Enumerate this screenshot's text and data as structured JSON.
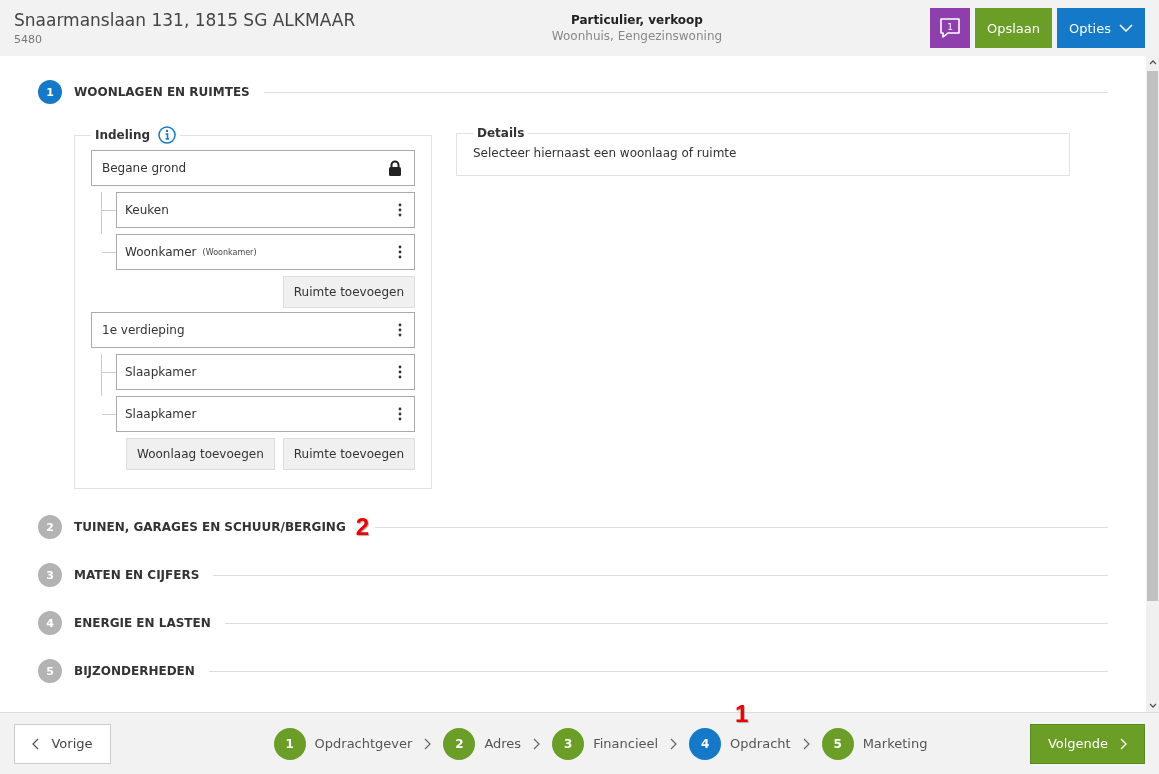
{
  "header": {
    "address": "Snaarmanslaan 131, 1815 SG ALKMAAR",
    "id": "5480",
    "type_title": "Particulier, verkoop",
    "type_subtitle": "Woonhuis, Eengezinswoning",
    "message_count": "1",
    "save_label": "Opslaan",
    "options_label": "Opties"
  },
  "sections": [
    {
      "number": "1",
      "title": "WOONLAGEN EN RUIMTES",
      "selected": true
    },
    {
      "number": "2",
      "title": "TUINEN, GARAGES EN SCHUUR/BERGING",
      "selected": false,
      "callout": "2"
    },
    {
      "number": "3",
      "title": "MATEN EN CIJFERS",
      "selected": false
    },
    {
      "number": "4",
      "title": "ENERGIE EN LASTEN",
      "selected": false
    },
    {
      "number": "5",
      "title": "BIJZONDERHEDEN",
      "selected": false
    }
  ],
  "layout": {
    "title": "Indeling",
    "floors": [
      {
        "name": "Begane grond",
        "kind": "locked",
        "rooms": [
          {
            "name": "Keuken"
          },
          {
            "name": "Woonkamer",
            "type": "(Woonkamer)"
          }
        ],
        "buttons": [
          "Ruimte toevoegen"
        ]
      },
      {
        "name": "1e verdieping",
        "kind": "menu",
        "rooms": [
          {
            "name": "Slaapkamer"
          },
          {
            "name": "Slaapkamer"
          }
        ],
        "buttons": [
          "Woonlaag toevoegen",
          "Ruimte toevoegen"
        ]
      }
    ]
  },
  "details": {
    "title": "Details",
    "text": "Selecteer hiernaast een woonlaag of ruimte"
  },
  "footer": {
    "back_label": "Vorige",
    "next_label": "Volgende",
    "steps": [
      {
        "number": "1",
        "label": "Opdrachtgever",
        "selected": false
      },
      {
        "number": "2",
        "label": "Adres",
        "selected": false
      },
      {
        "number": "3",
        "label": "Financieel",
        "selected": false
      },
      {
        "number": "4",
        "label": "Opdracht",
        "selected": true,
        "callout": "1"
      },
      {
        "number": "5",
        "label": "Marketing",
        "selected": false
      }
    ]
  }
}
